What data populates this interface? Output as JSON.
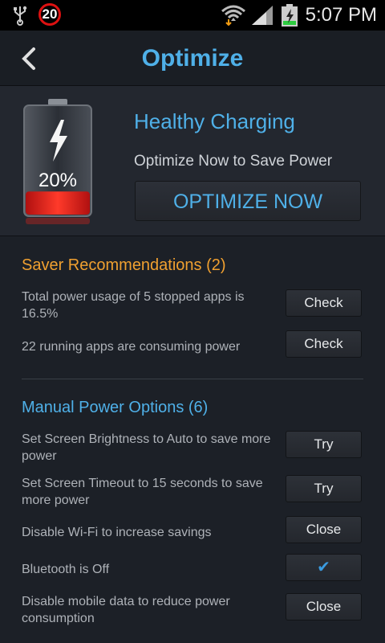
{
  "status_bar": {
    "notification_count": "20",
    "time": "5:07 PM"
  },
  "header": {
    "title": "Optimize"
  },
  "top_panel": {
    "battery_percent": "20%",
    "battery_level": 0.2,
    "status_title": "Healthy Charging",
    "status_subtitle": "Optimize Now to Save Power",
    "optimize_button": "OPTIMIZE NOW"
  },
  "saver_recommendations": {
    "title": "Saver Recommendations (2)",
    "items": [
      {
        "text": "Total power usage of 5 stopped apps is 16.5%",
        "action": "Check"
      },
      {
        "text": "22 running apps are consuming power",
        "action": "Check"
      }
    ]
  },
  "manual_power_options": {
    "title": "Manual Power Options (6)",
    "items": [
      {
        "text": "Set Screen Brightness to Auto to save more power",
        "action": "Try"
      },
      {
        "text": "Set Screen Timeout to 15 seconds to save more power",
        "action": "Try"
      },
      {
        "text": "Disable Wi-Fi to increase savings",
        "action": "Close"
      },
      {
        "text": "Bluetooth is Off",
        "action": "✔"
      },
      {
        "text": "Disable mobile data to reduce power consumption",
        "action": "Close"
      }
    ]
  },
  "colors": {
    "accent_blue": "#4fb0e8",
    "section_orange": "#f0a030",
    "battery_red": "#e8231a"
  }
}
